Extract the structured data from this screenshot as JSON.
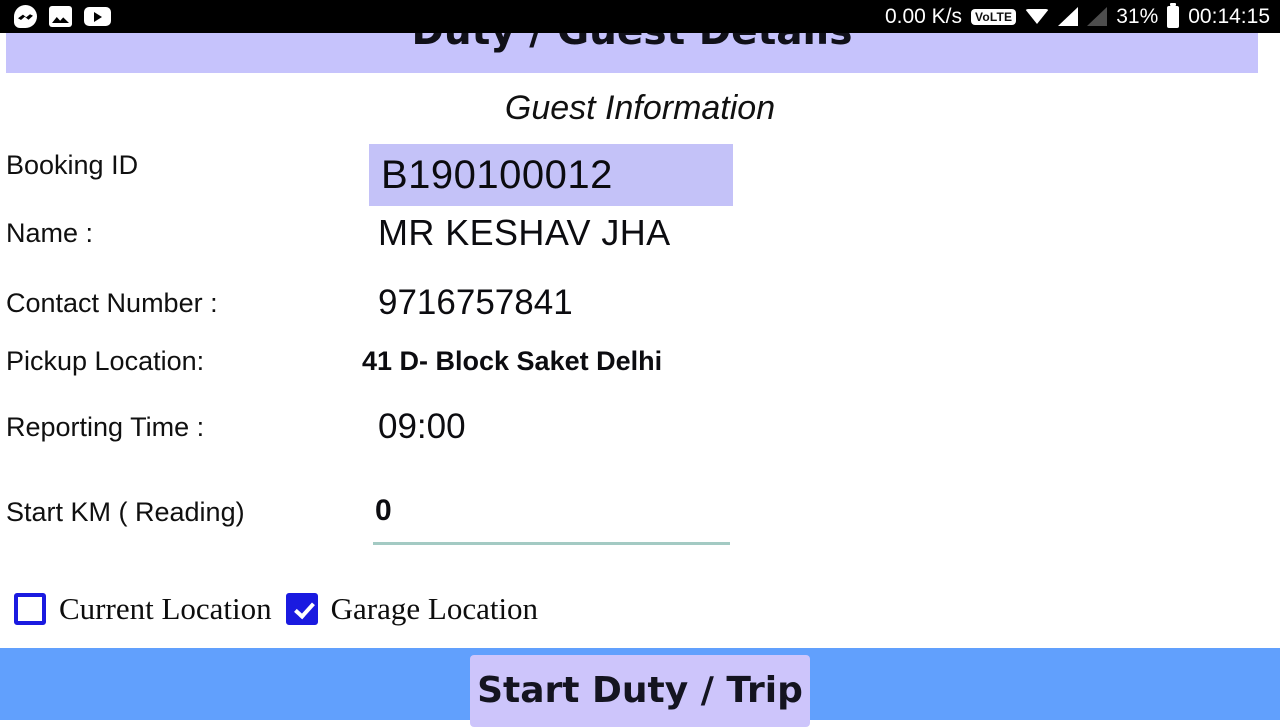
{
  "statusbar": {
    "app_icons": [
      "messenger-icon",
      "photos-icon",
      "youtube-icon"
    ],
    "network_speed": "0.00 K/s",
    "volte": "VoLTE",
    "battery_percent": "31%",
    "clock": "00:14:15",
    "icons": [
      "wifi-icon",
      "signal-sim1-icon",
      "signal-sim2-icon",
      "battery-icon"
    ]
  },
  "header": {
    "title": "Duty / Guest Details",
    "bar_color": "#c6c3fc"
  },
  "main": {
    "section_title": "Guest Information",
    "fields": [
      {
        "label": "Booking ID",
        "value": "B190100012"
      },
      {
        "label": "Name :",
        "value": "MR  KESHAV JHA"
      },
      {
        "label": "Contact Number :",
        "value": "9716757841"
      },
      {
        "label": "Pickup Location:",
        "value": "41 D- Block Saket Delhi"
      },
      {
        "label": "Reporting Time :",
        "value": "09:00"
      },
      {
        "label": "Start KM ( Reading)",
        "value": "0"
      }
    ],
    "booking_highlight_color": "#c4c2f8",
    "km_underline_color": "#a3cac3",
    "checkboxes": [
      {
        "label": "Current Location",
        "checked": false
      },
      {
        "label": "Garage Location",
        "checked": true
      }
    ],
    "checkbox_color": "#1a1ae0"
  },
  "footer": {
    "bar_color": "#61a0fd",
    "button_label": "Start Duty / Trip",
    "button_color": "#cdc5fb"
  }
}
